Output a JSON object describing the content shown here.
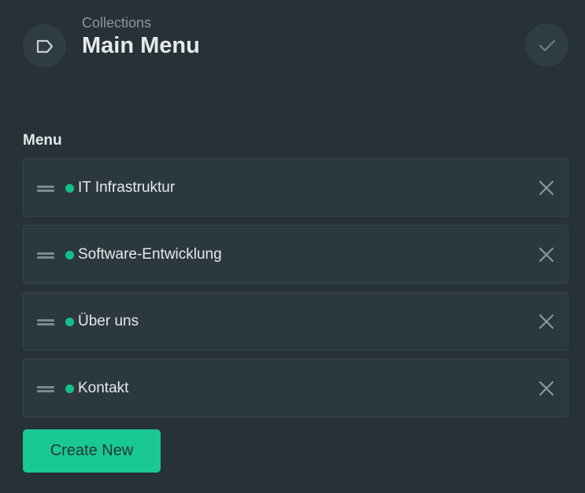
{
  "header": {
    "breadcrumb": "Collections",
    "title": "Main Menu",
    "collection_icon": "tag-icon",
    "save_icon": "check-icon"
  },
  "field": {
    "label": "Menu"
  },
  "menu_items": [
    {
      "label": "IT Infrastruktur",
      "status_color": "#15c18b"
    },
    {
      "label": "Software-Entwicklung",
      "status_color": "#15c18b"
    },
    {
      "label": "Über uns",
      "status_color": "#15c18b"
    },
    {
      "label": "Kontakt",
      "status_color": "#15c18b"
    }
  ],
  "actions": {
    "create_label": "Create New"
  },
  "colors": {
    "background": "#263238",
    "accent": "#1ac891",
    "status_published": "#15c18b"
  }
}
